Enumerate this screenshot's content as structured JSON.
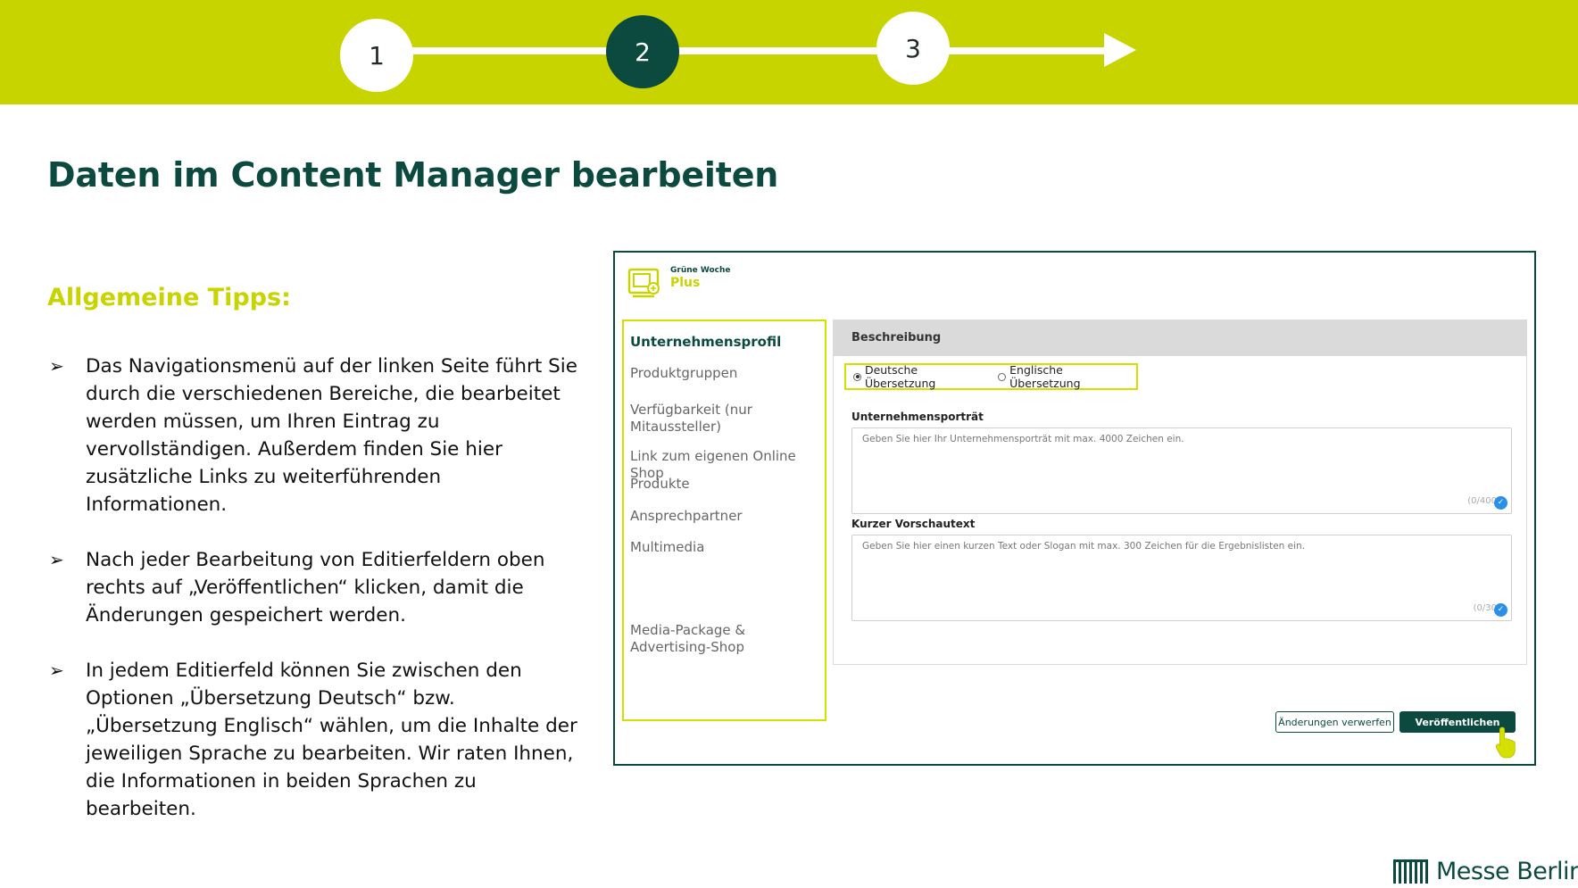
{
  "steps": {
    "one": "1",
    "two": "2",
    "three": "3"
  },
  "page_title": "Daten im Content Manager bearbeiten",
  "tips_title": "Allgemeine Tipps:",
  "tips": [
    "Das Navigationsmenü auf der linken Seite führt Sie durch die verschiedenen Bereiche, die bearbeitet werden müssen, um Ihren Eintrag zu vervollständigen. Außerdem finden Sie hier zusätzliche Links zu weiterführenden Informationen.",
    "Nach jeder Bearbeitung von Editierfeldern oben rechts auf „Veröffentlichen“ klicken, damit die Änderungen gespeichert werden.",
    "In jedem Editierfeld können Sie zwischen den Optionen „Übersetzung Deutsch“ bzw. „Übersetzung Englisch“ wählen, um die Inhalte der jeweiligen Sprache zu bearbeiten. Wir raten Ihnen, die Informationen in beiden Sprachen zu bearbeiten."
  ],
  "app": {
    "logo_top": "Grüne Woche",
    "logo_bottom": "Plus",
    "nav": [
      "Unternehmensprofil",
      "Produktgruppen",
      "Verfügbarkeit (nur Mitaussteller)",
      "Link zum eigenen Online Shop",
      "Produkte",
      "Ansprechpartner",
      "Multimedia",
      "Media-Package & Advertising-Shop"
    ],
    "section_title": "Beschreibung",
    "lang_german": "Deutsche Übersetzung",
    "lang_english": "Englische Übersetzung",
    "selected_language": "Deutsche Übersetzung",
    "field1_label": "Unternehmensporträt",
    "field1_placeholder": "Geben Sie hier Ihr Unternehmensporträt mit max. 4000 Zeichen ein.",
    "field1_count": "(0/400",
    "field2_label": "Kurzer Vorschautext",
    "field2_placeholder": "Geben Sie hier einen kurzen Text oder Slogan mit max. 300 Zeichen für die Ergebnislisten ein.",
    "field2_count": "(0/30",
    "discard_label": "Änderungen verwerfen",
    "publish_label": "Veröffentlichen"
  },
  "brand": "Messe Berlin",
  "colors": {
    "lime": "#c8d400",
    "dark_green": "#0c4a40",
    "check_blue": "#2a8fe8"
  }
}
